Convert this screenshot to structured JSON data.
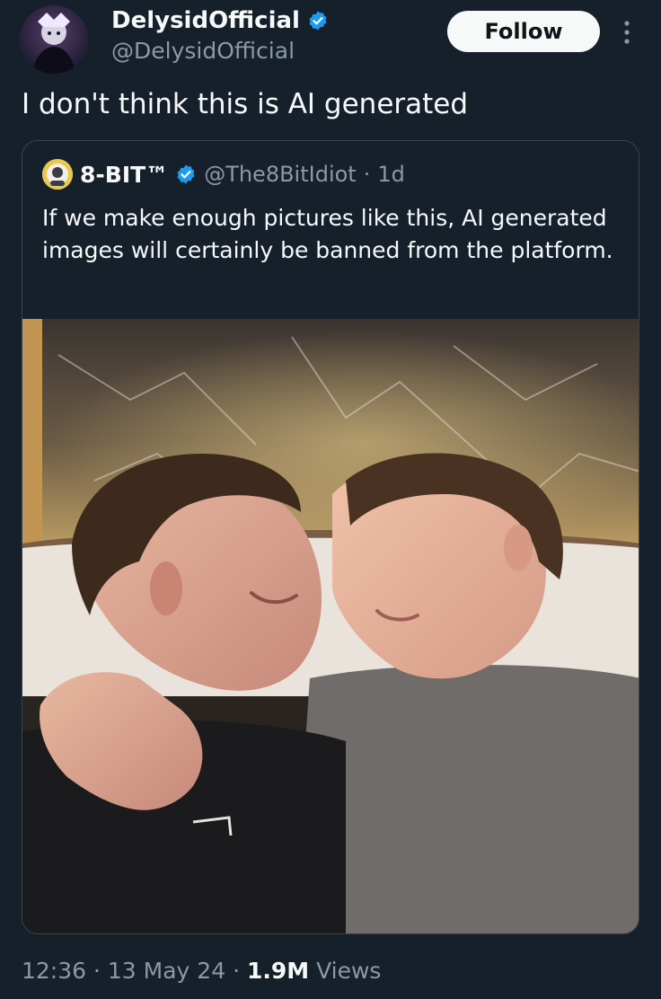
{
  "author": {
    "display_name": "DelysidOfficial",
    "handle": "@DelysidOfficial",
    "verified": true
  },
  "follow_label": "Follow",
  "tweet_text": "I don't think this is AI generated",
  "quoted_tweet": {
    "display_name": "8-BIT™",
    "handle": "@The8BitIdiot",
    "time_ago": "1d",
    "separator": "·",
    "verified": true,
    "text": "If we make enough pictures like this, AI generated images will certainly be banned from the platform."
  },
  "meta": {
    "time": "12:36",
    "date": "13 May 24",
    "separator": "·",
    "views_count": "1.9M",
    "views_label": "Views"
  },
  "colors": {
    "background": "#15202b",
    "verified": "#1d9bf0",
    "secondary_text": "#8b98a5",
    "border": "#38444d"
  },
  "icons": {
    "verified": "verified-badge-icon",
    "more": "more-options-icon"
  }
}
